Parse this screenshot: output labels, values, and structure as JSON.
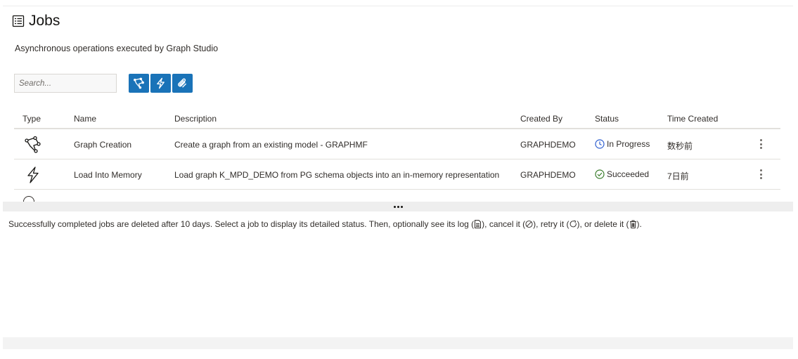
{
  "page": {
    "title": "Jobs",
    "subtitle": "Asynchronous operations executed by Graph Studio"
  },
  "toolbar": {
    "search_placeholder": "Search...",
    "buttons": [
      {
        "icon": "graph-creation-icon"
      },
      {
        "icon": "lightning-icon"
      },
      {
        "icon": "paperclip-icon"
      }
    ],
    "accent_color": "#1a73b8"
  },
  "table": {
    "headers": {
      "type": "Type",
      "name": "Name",
      "description": "Description",
      "created_by": "Created By",
      "status": "Status",
      "time_created": "Time Created"
    },
    "rows": [
      {
        "type_icon": "graph-creation-icon",
        "name": "Graph Creation",
        "description": "Create a graph from an existing model - GRAPHMF",
        "created_by": "GRAPHDEMO",
        "status": "In Progress",
        "status_icon": "clock-icon",
        "status_color": "#2f5fd0",
        "time_created": "数秒前"
      },
      {
        "type_icon": "lightning-icon",
        "name": "Load Into Memory",
        "description": "Load graph K_MPD_DEMO from PG schema objects into an in-memory representation",
        "created_by": "GRAPHDEMO",
        "status": "Succeeded",
        "status_icon": "check-circle-icon",
        "status_color": "#3a7d2c",
        "time_created": "7日前"
      }
    ]
  },
  "footnote": {
    "part1": "Successfully completed jobs are deleted after 10 days. Select a job to display its detailed status. Then, optionally see its log (",
    "part2": "), cancel it (",
    "part3": "), retry it (",
    "part4": "), or delete it (",
    "part5": ")."
  }
}
